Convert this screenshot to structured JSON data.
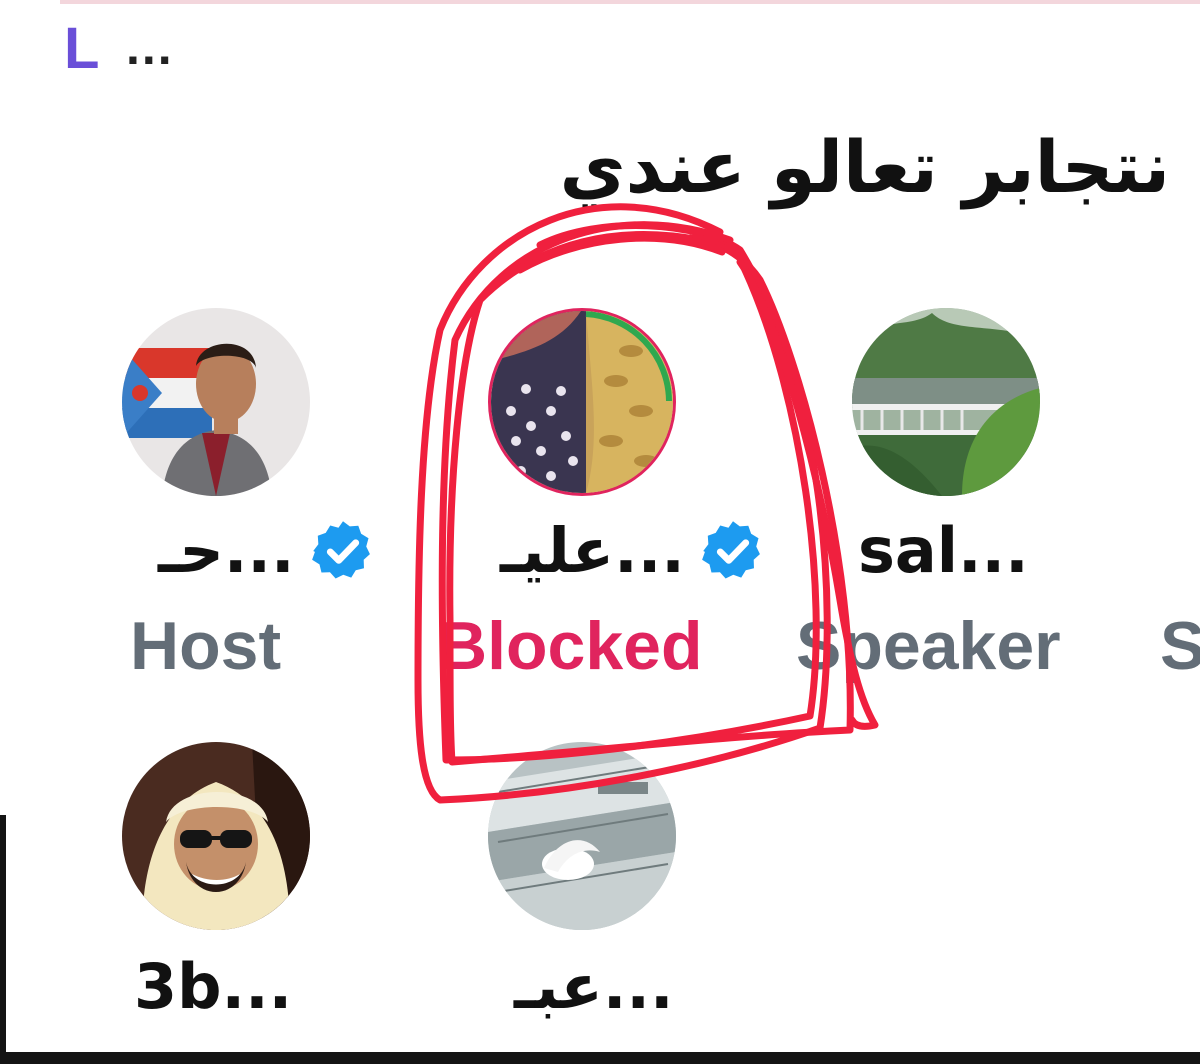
{
  "header": {
    "label": "L",
    "more": "..."
  },
  "space": {
    "title": "نتجابر تعالو عندي"
  },
  "participants": [
    {
      "name": "حـ...",
      "role": "Host",
      "verified": true,
      "avatar_icon": "user-avatar-photo"
    },
    {
      "name": "عليـ...",
      "role": "Blocked",
      "verified": true,
      "avatar_icon": "user-avatar-photo",
      "role_color": "#e0245e"
    },
    {
      "name": "sal...",
      "role": "Speaker",
      "verified": false,
      "avatar_icon": "user-avatar-photo"
    },
    {
      "name": "",
      "role": "S",
      "verified": false
    },
    {
      "name": "3b...",
      "role": "",
      "verified": false,
      "avatar_icon": "user-avatar-photo"
    },
    {
      "name": "عبـ...",
      "role": "",
      "verified": false,
      "avatar_icon": "user-avatar-photo"
    }
  ],
  "colors": {
    "accent": "#6a4fd8",
    "verified": "#1d9bf0",
    "blocked": "#e0245e",
    "role_text": "#636d77",
    "annotation": "#f0203e"
  }
}
